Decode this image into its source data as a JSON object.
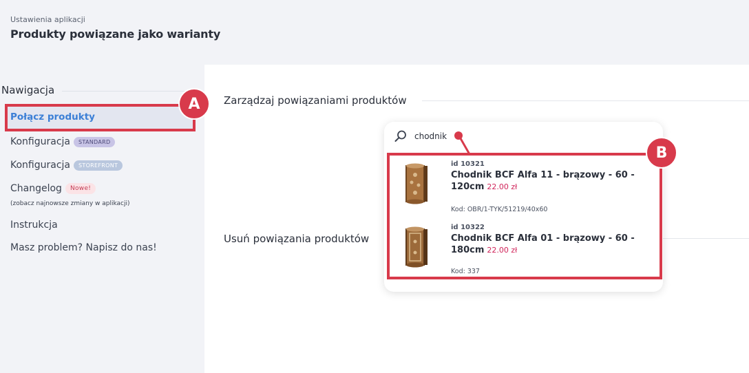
{
  "header": {
    "breadcrumb": "Ustawienia aplikacji",
    "title": "Produkty powiązane jako warianty"
  },
  "sidebar": {
    "title": "Nawigacja",
    "items": [
      {
        "label": "Połącz produkty",
        "active": true
      },
      {
        "label": "Konfiguracja",
        "badge": "STANDARD"
      },
      {
        "label": "Konfiguracja",
        "badge": "STOREFRONT"
      },
      {
        "label": "Changelog",
        "badge": "Nowe!",
        "sub": "(zobacz najnowsze zmiany w aplikacji)"
      },
      {
        "label": "Instrukcja"
      },
      {
        "label": "Masz problem? Napisz do nas!"
      }
    ]
  },
  "main": {
    "section_manage": "Zarządzaj powiązaniami produktów",
    "section_remove": "Usuń powiązania produktów"
  },
  "search": {
    "value": "chodnik",
    "icon": "search-icon"
  },
  "results": [
    {
      "id": "id 10321",
      "name": "Chodnik BCF Alfa 11 - brązowy - 60 - 120cm",
      "price": "22.00 zł",
      "code": "Kod: OBR/1-TYK/51219/40x60"
    },
    {
      "id": "id 10322",
      "name": "Chodnik BCF Alfa 01 - brązowy - 60 - 180cm",
      "price": "22.00 zł",
      "code": "Kod: 337"
    }
  ],
  "annotations": {
    "marker_a": "A",
    "marker_b": "B"
  },
  "colors": {
    "accent": "#3b7fd6",
    "highlight": "#d83a4b",
    "price": "#d0245a"
  }
}
